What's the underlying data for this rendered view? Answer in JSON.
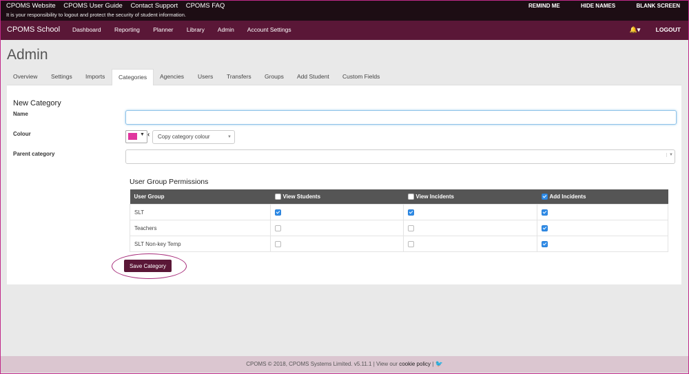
{
  "util": {
    "links": [
      "CPOMS Website",
      "CPOMS User Guide",
      "Contact Support",
      "CPOMS FAQ"
    ],
    "notice": "It is your responsibility to logout and protect the security of student information.",
    "right": [
      "REMIND ME",
      "HIDE NAMES",
      "BLANK SCREEN"
    ]
  },
  "nav": {
    "brand": "CPOMS School",
    "items": [
      "Dashboard",
      "Reporting",
      "Planner",
      "Library",
      "Admin",
      "Account Settings"
    ],
    "logout": "LOGOUT"
  },
  "page": {
    "title": "Admin",
    "tabs": [
      "Overview",
      "Settings",
      "Imports",
      "Categories",
      "Agencies",
      "Users",
      "Transfers",
      "Groups",
      "Add Student",
      "Custom Fields"
    ],
    "active_tab": "Categories"
  },
  "form": {
    "section_title": "New Category",
    "name_label": "Name",
    "name_value": "",
    "colour_label": "Colour",
    "colour_value": "#e0369e",
    "copy_colour_label": "Copy category colour",
    "parent_label": "Parent category",
    "parent_value": "",
    "permissions_title": "User Group Permissions",
    "columns": [
      "User Group",
      "View Students",
      "View Incidents",
      "Add Incidents"
    ],
    "header_checked": [
      false,
      false,
      true
    ],
    "rows": [
      {
        "group": "SLT",
        "view_students": true,
        "view_incidents": true,
        "add_incidents": true
      },
      {
        "group": "Teachers",
        "view_students": false,
        "view_incidents": false,
        "add_incidents": true
      },
      {
        "group": "SLT Non-key Temp",
        "view_students": false,
        "view_incidents": false,
        "add_incidents": true
      }
    ],
    "save_label": "Save Category"
  },
  "footer": {
    "text": "CPOMS © 2018, CPOMS Systems Limited. v5.11.1 | View our ",
    "link": "cookie policy",
    "after": " | "
  },
  "icons": {
    "bell": "bell-icon",
    "twitter": "twitter-icon"
  }
}
